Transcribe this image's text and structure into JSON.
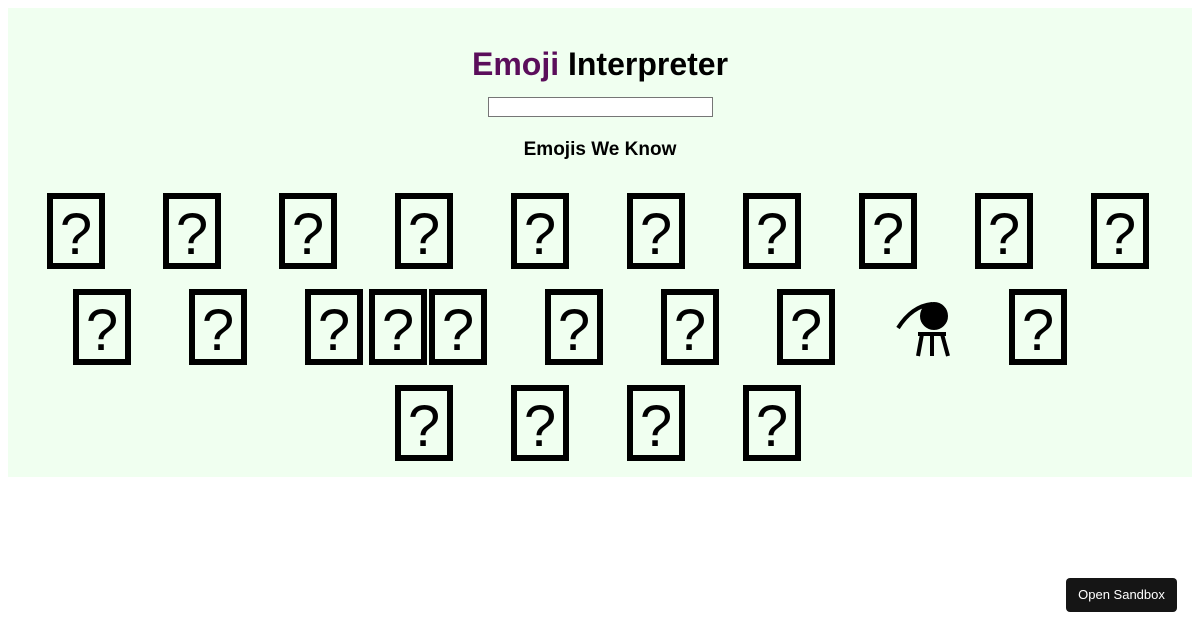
{
  "app": {
    "title_accent": "Emoji",
    "title_rest": "Interpreter",
    "accent_color": "#5b0e5b",
    "background_color": "#f0fff0"
  },
  "search": {
    "value": "",
    "placeholder": ""
  },
  "section": {
    "heading": "Emojis We Know"
  },
  "emojis": [
    {
      "glyph": "missing-glyph-box"
    },
    {
      "glyph": "missing-glyph-box"
    },
    {
      "glyph": "missing-glyph-box"
    },
    {
      "glyph": "missing-glyph-box"
    },
    {
      "glyph": "missing-glyph-box"
    },
    {
      "glyph": "missing-glyph-box"
    },
    {
      "glyph": "missing-glyph-box"
    },
    {
      "glyph": "missing-glyph-box"
    },
    {
      "glyph": "missing-glyph-box"
    },
    {
      "glyph": "missing-glyph-box"
    },
    {
      "glyph": "missing-glyph-box"
    },
    {
      "glyph": "missing-glyph-box"
    },
    {
      "glyph": "missing-glyph-box-double"
    },
    {
      "glyph": "missing-glyph-box"
    },
    {
      "glyph": "missing-glyph-box"
    },
    {
      "glyph": "missing-glyph-box"
    },
    {
      "glyph": "missing-glyph-box"
    },
    {
      "glyph": "person-in-lotus-position"
    },
    {
      "glyph": "missing-glyph-box"
    },
    {
      "glyph": "missing-glyph-box"
    },
    {
      "glyph": "missing-glyph-box"
    },
    {
      "glyph": "missing-glyph-box"
    },
    {
      "glyph": "missing-glyph-box"
    }
  ],
  "footer": {
    "sandbox_label": "Open Sandbox"
  }
}
